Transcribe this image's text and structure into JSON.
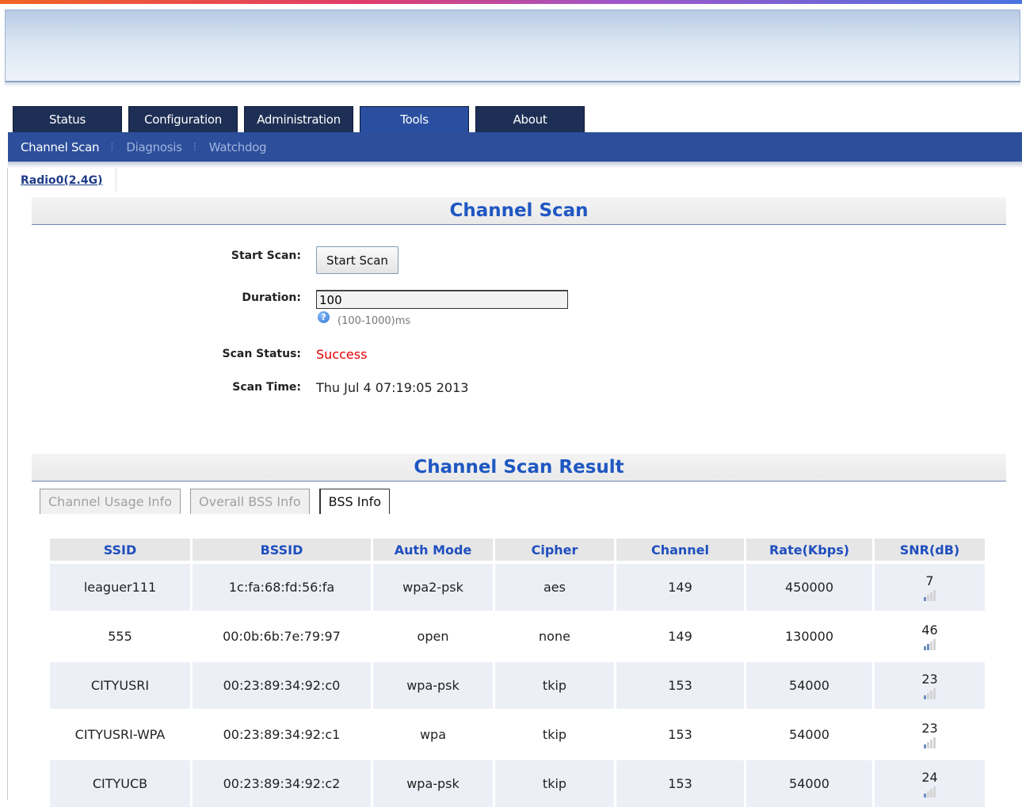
{
  "top_tabs": [
    "Status",
    "Configuration",
    "Administration",
    "Tools",
    "About"
  ],
  "active_top_tab": "Tools",
  "sub_nav": {
    "items": [
      "Channel Scan",
      "Diagnosis",
      "Watchdog"
    ],
    "active": "Channel Scan",
    "separator": "⁝"
  },
  "radio_link": "Radio0(2.4G)",
  "scan_section": {
    "title": "Channel Scan",
    "start_scan_label": "Start Scan:",
    "start_scan_button": "Start Scan",
    "duration_label": "Duration:",
    "duration_value": "100",
    "duration_hint": "(100-1000)ms",
    "help_icon": "?",
    "scan_status_label": "Scan Status:",
    "scan_status_value": "Success",
    "scan_time_label": "Scan Time:",
    "scan_time_value": "Thu Jul 4 07:19:05 2013"
  },
  "result_section": {
    "title": "Channel Scan Result",
    "tabs": [
      "Channel Usage Info",
      "Overall BSS Info",
      "BSS Info"
    ],
    "active_tab": "BSS Info"
  },
  "table": {
    "headers": [
      "SSID",
      "BSSID",
      "Auth Mode",
      "Cipher",
      "Channel",
      "Rate(Kbps)",
      "SNR(dB)"
    ],
    "rows": [
      {
        "ssid": "leaguer111",
        "bssid": "1c:fa:68:fd:56:fa",
        "auth": "wpa2-psk",
        "cipher": "aes",
        "channel": "149",
        "rate": "450000",
        "snr": "7",
        "signal_bars": 1
      },
      {
        "ssid": "555",
        "bssid": "00:0b:6b:7e:79:97",
        "auth": "open",
        "cipher": "none",
        "channel": "149",
        "rate": "130000",
        "snr": "46",
        "signal_bars": 2
      },
      {
        "ssid": "CITYUSRI",
        "bssid": "00:23:89:34:92:c0",
        "auth": "wpa-psk",
        "cipher": "tkip",
        "channel": "153",
        "rate": "54000",
        "snr": "23",
        "signal_bars": 1
      },
      {
        "ssid": "CITYUSRI-WPA",
        "bssid": "00:23:89:34:92:c1",
        "auth": "wpa",
        "cipher": "tkip",
        "channel": "153",
        "rate": "54000",
        "snr": "23",
        "signal_bars": 1
      },
      {
        "ssid": "CITYUCB",
        "bssid": "00:23:89:34:92:c2",
        "auth": "wpa-psk",
        "cipher": "tkip",
        "channel": "153",
        "rate": "54000",
        "snr": "24",
        "signal_bars": 1
      }
    ]
  },
  "colors": {
    "nav_dark": "#1e2f55",
    "subnav_blue": "#2c4e9b",
    "heading_blue": "#1f57c2",
    "status_red": "#e60000"
  }
}
